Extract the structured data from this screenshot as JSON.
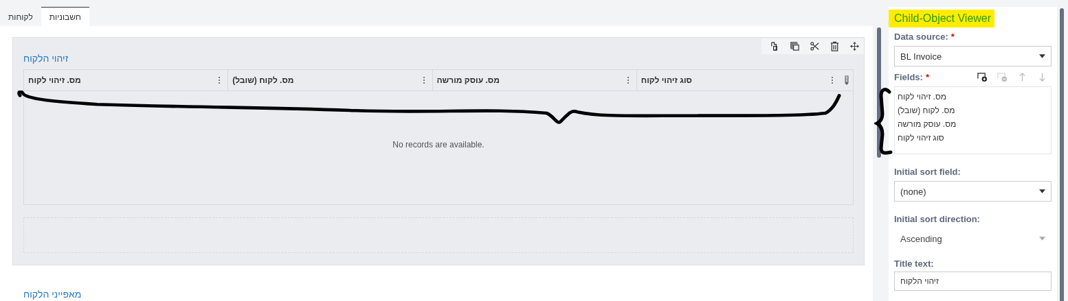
{
  "tabs": [
    {
      "label": "חשבוניות",
      "selected": true
    },
    {
      "label": "לקוחות",
      "selected": false
    }
  ],
  "section": {
    "title": "זיהוי הלקוח",
    "columns": [
      "סוג זיהוי לקוח",
      "מס. עוסק מורשה",
      "מס. לקוח (שובל)",
      "מס. זיהוי לקוח"
    ],
    "empty_message": "No records are available."
  },
  "next_section": {
    "title": "מאפייני הלקוח"
  },
  "panel": {
    "title": "Child-Object Viewer",
    "data_source": {
      "label": "Data source:",
      "marker": "*",
      "value": "BL Invoice"
    },
    "fields": {
      "label": "Fields:",
      "marker": "*",
      "items": [
        "מס. זיהוי לקוח",
        "מס. לקוח (שובל)",
        "מס. עוסק מורשה",
        "סוג זיהוי לקוח"
      ],
      "tools": [
        {
          "kind": "add",
          "disabled": false
        },
        {
          "kind": "remove",
          "disabled": true
        },
        {
          "kind": "up",
          "disabled": true
        },
        {
          "kind": "down",
          "disabled": true
        }
      ]
    },
    "sort_field": {
      "label": "Initial sort field:",
      "value": "(none)"
    },
    "sort_direction": {
      "label": "Initial sort direction:",
      "value": "Ascending",
      "disabled": true
    },
    "title_text": {
      "label": "Title text:",
      "value": "זיהוי הלקוח"
    }
  }
}
